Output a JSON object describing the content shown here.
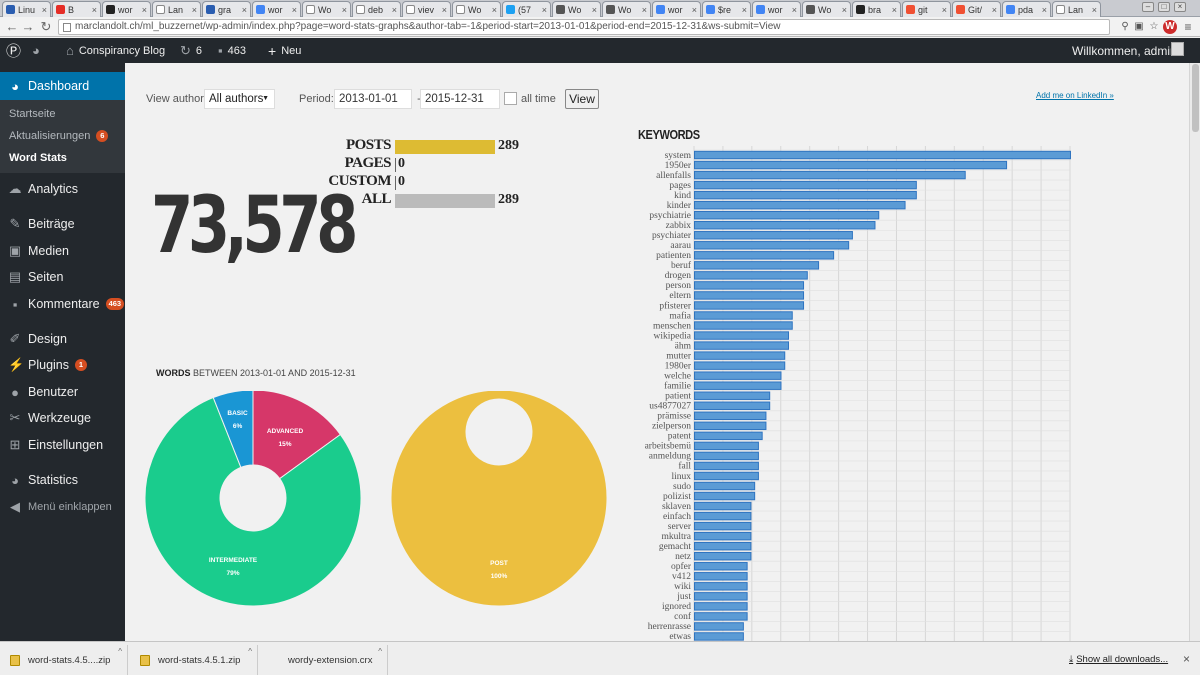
{
  "browser": {
    "tabs": [
      {
        "title": "Linu",
        "icon": "play-icon",
        "color": "#2a5db0"
      },
      {
        "title": "B",
        "icon": "youtube-icon",
        "color": "#e52d27"
      },
      {
        "title": "wor",
        "icon": "github-icon",
        "color": "#222222"
      },
      {
        "title": "Lan",
        "icon": "page-icon",
        "color": "#ffffff"
      },
      {
        "title": "gra",
        "icon": "ol-icon",
        "color": "#2a5db0"
      },
      {
        "title": "wor",
        "icon": "google-icon",
        "color": "#4285f4"
      },
      {
        "title": "Wo",
        "icon": "page-icon",
        "color": "#ffffff"
      },
      {
        "title": "deb",
        "icon": "page-icon",
        "color": "#ffffff"
      },
      {
        "title": "viev",
        "icon": "page-icon",
        "color": "#ffffff"
      },
      {
        "title": "Wo",
        "icon": "page-icon",
        "color": "#ffffff"
      },
      {
        "title": "(57",
        "icon": "twitter-icon",
        "color": "#1da1f2"
      },
      {
        "title": "Wo",
        "icon": "wordpress-icon",
        "color": "#555555"
      },
      {
        "title": "Wo",
        "icon": "wordpress-icon",
        "color": "#555555"
      },
      {
        "title": "wor",
        "icon": "google-icon",
        "color": "#4285f4"
      },
      {
        "title": "$re",
        "icon": "google-icon",
        "color": "#4285f4"
      },
      {
        "title": "wor",
        "icon": "google-icon",
        "color": "#4285f4"
      },
      {
        "title": "Wo",
        "icon": "wordpress-icon",
        "color": "#555555"
      },
      {
        "title": "bra",
        "icon": "github-icon",
        "color": "#222222"
      },
      {
        "title": "git",
        "icon": "git-icon",
        "color": "#f05033"
      },
      {
        "title": "Git/",
        "icon": "git-icon",
        "color": "#f05033"
      },
      {
        "title": "pda",
        "icon": "google-icon",
        "color": "#4285f4"
      },
      {
        "title": "Lan",
        "icon": "page-icon",
        "color": "#ffffff"
      }
    ],
    "url": "marclandolt.ch/ml_buzzernet/wp-admin/index.php?page=word-stats-graphs&author-tab=-1&period-start=2013-01-01&period-end=2015-12-31&ws-submit=View"
  },
  "adminbar": {
    "site_name": "Conspirancy Blog",
    "updates_count": "6",
    "comments_count": "463",
    "new_label": "Neu",
    "greeting": "Willkommen, admin"
  },
  "sidebar": {
    "dashboard": "Dashboard",
    "sub": [
      {
        "label": "Startseite"
      },
      {
        "label": "Aktualisierungen",
        "badge": "6"
      },
      {
        "label": "Word Stats"
      }
    ],
    "items": [
      {
        "label": "Analytics",
        "icon": "analytics-icon"
      },
      {
        "label": "Beiträge",
        "icon": "pin-icon"
      },
      {
        "label": "Medien",
        "icon": "media-icon"
      },
      {
        "label": "Seiten",
        "icon": "pages-icon"
      },
      {
        "label": "Kommentare",
        "icon": "comments-icon",
        "badge": "463"
      },
      {
        "label": "Design",
        "icon": "brush-icon"
      },
      {
        "label": "Plugins",
        "icon": "plugin-icon",
        "badge": "1"
      },
      {
        "label": "Benutzer",
        "icon": "user-icon"
      },
      {
        "label": "Werkzeuge",
        "icon": "wrench-icon"
      },
      {
        "label": "Einstellungen",
        "icon": "settings-icon"
      },
      {
        "label": "Statistics",
        "icon": "pie-icon"
      },
      {
        "label": "Menü einklappen",
        "icon": "collapse-icon"
      }
    ]
  },
  "filters": {
    "view_author_label": "View author:",
    "author_value": "All authors",
    "period_label": "Period:",
    "start": "2013-01-01",
    "dash": "-",
    "end": "2015-12-31",
    "alltime_label": "all time",
    "view_button": "View"
  },
  "linkedin": "Add me on LinkedIn »",
  "total_words": "73,578",
  "counts": [
    {
      "label": "POSTS",
      "value": "289",
      "color": "#ddbb33"
    },
    {
      "label": "PAGES",
      "value": "0",
      "color": "#ddbb33"
    },
    {
      "label": "CUSTOM",
      "value": "0",
      "color": "#ddbb33"
    },
    {
      "label": "ALL",
      "value": "289",
      "color": "#bbbbbb"
    }
  ],
  "words_heading": {
    "bold": "WORDS",
    "rest": "BETWEEN 2013-01-01 AND 2015-12-31"
  },
  "chart_data": [
    {
      "type": "pie",
      "categories": [
        "ADVANCED",
        "INTERMEDIATE",
        "BASIC"
      ],
      "values": [
        15,
        79,
        6
      ],
      "labels": [
        "15%",
        "79%",
        "6%"
      ],
      "colors": [
        "#d63769",
        "#1acc8d",
        "#1a96d4"
      ]
    },
    {
      "type": "pie",
      "categories": [
        "POST"
      ],
      "values": [
        100
      ],
      "labels": [
        "100%"
      ],
      "colors": [
        "#ecbf3f"
      ]
    },
    {
      "type": "bar",
      "title": "KEYWORDS",
      "orientation": "horizontal",
      "categories": [
        "system",
        "1950er",
        "allenfalls",
        "pages",
        "kind",
        "kinder",
        "psychiatrie",
        "zabbix",
        "psychiater",
        "aarau",
        "patienten",
        "beruf",
        "drogen",
        "person",
        "eltern",
        "pfisterer",
        "mafia",
        "menschen",
        "wikipedia",
        "ähm",
        "mutter",
        "1980er",
        "welche",
        "familie",
        "patient",
        "us4877027",
        "prämisse",
        "zielperson",
        "patent",
        "arbeitsbemü",
        "anmeldung",
        "fall",
        "linux",
        "sudo",
        "polizist",
        "sklaven",
        "einfach",
        "server",
        "mkultra",
        "gemacht",
        "netz",
        "opfer",
        "v412",
        "wiki",
        "just",
        "ignored",
        "conf",
        "herrenrasse",
        "etwas"
      ],
      "values": [
        100,
        83,
        72,
        59,
        59,
        56,
        49,
        48,
        42,
        41,
        37,
        33,
        30,
        29,
        29,
        29,
        26,
        26,
        25,
        25,
        24,
        24,
        23,
        23,
        20,
        20,
        19,
        19,
        18,
        17,
        17,
        17,
        17,
        16,
        16,
        15,
        15,
        15,
        15,
        15,
        15,
        14,
        14,
        14,
        14,
        14,
        14,
        13,
        13
      ],
      "xlim": [
        0,
        100
      ],
      "bar_color": "#5b9bd5",
      "grid": true
    }
  ],
  "downloads": [
    {
      "name": "word-stats.4.5....zip"
    },
    {
      "name": "word-stats.4.5.1.zip"
    },
    {
      "name": "wordy-extension.crx"
    }
  ],
  "show_all": "Show all downloads..."
}
